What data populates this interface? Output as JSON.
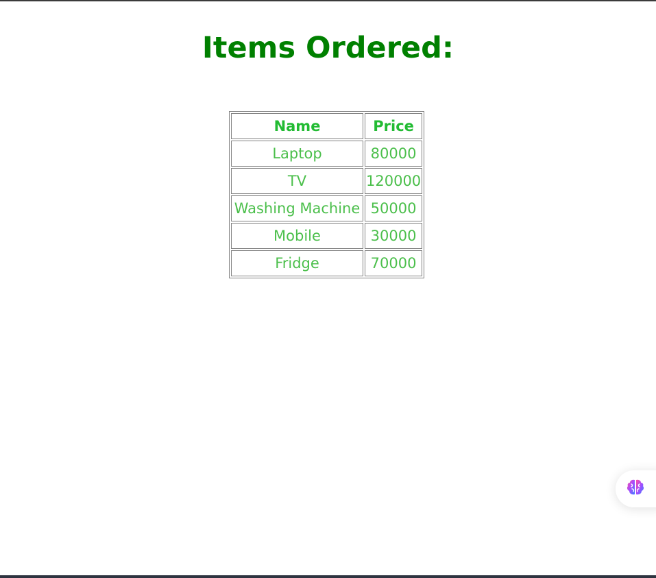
{
  "page": {
    "title": "Items Ordered:"
  },
  "table": {
    "headers": {
      "name": "Name",
      "price": "Price"
    },
    "rows": [
      {
        "name": "Laptop",
        "price": "80000"
      },
      {
        "name": "TV",
        "price": "120000"
      },
      {
        "name": "Washing Machine",
        "price": "50000"
      },
      {
        "name": "Mobile",
        "price": "30000"
      },
      {
        "name": "Fridge",
        "price": "70000"
      }
    ]
  },
  "assistant": {
    "icon": "brain-icon"
  },
  "colors": {
    "title": "#008000",
    "header_text": "#22bb33",
    "cell_text": "#4bbf4b",
    "border": "#808080"
  }
}
